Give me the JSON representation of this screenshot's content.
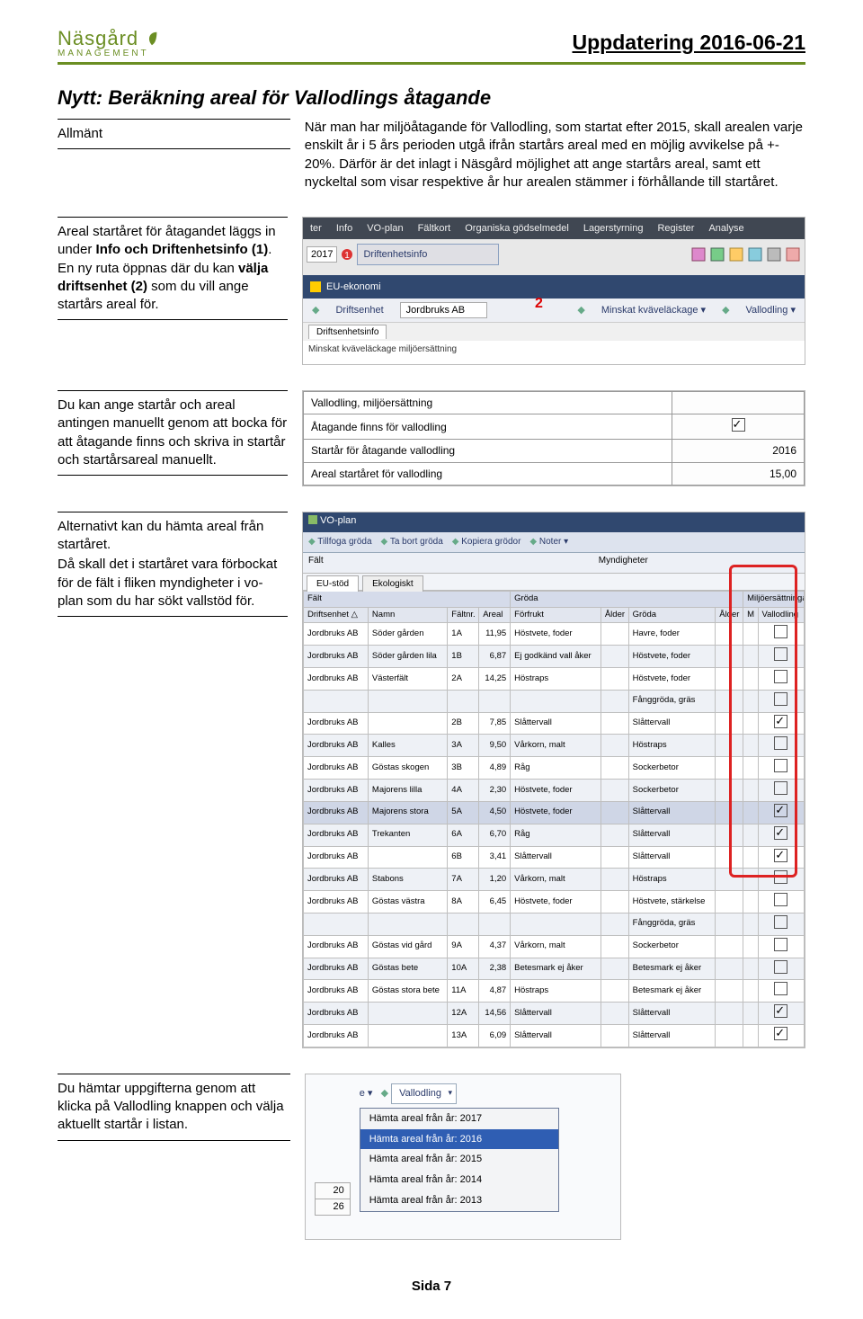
{
  "header": {
    "logo_top": "Näsgård",
    "logo_bottom": "MANAGEMENT",
    "doc_title": "Uppdatering 2016-06-21"
  },
  "section_title": "Nytt: Beräkning areal för Vallodlings åtagande",
  "block1": {
    "label": "Allmänt",
    "body": "När man har miljöåtagande för Vallodling, som startat efter 2015, skall arealen varje enskilt år i 5 års perioden utgå ifrån startårs areal med en möjlig avvikelse på +- 20%. Därför är det inlagt i Näsgård möjlighet att ange startårs areal, samt ett nyckeltal som visar respektive år hur arealen stämmer i förhållande till startåret."
  },
  "block2": {
    "text_a": "Areal startåret för åtagandet läggs in under ",
    "bold_a": "Info och Driftenhetsinfo (1)",
    "text_b": ". En ny ruta öppnas där du kan ",
    "bold_b": "välja driftsenhet (2)",
    "text_c": " som du vill ange startårs areal för."
  },
  "img1": {
    "menu": [
      "ter",
      "Info",
      "VO-plan",
      "Fältkort",
      "Organiska gödselmedel",
      "Lagerstyrning",
      "Register",
      "Analyse"
    ],
    "year_btn": "2017",
    "dropdown": "Driftenhetsinfo",
    "eu_header": "EU-ekonomi",
    "driftsenhet_label": "Driftsenhet",
    "driftsenhet_value": "Jordbruks AB",
    "minskat": "Minskat kväveläckage ▾",
    "vallodling": "Vallodling ▾",
    "tab": "Driftsenhetsinfo",
    "subline": "Minskat kväveläckage  miljöersättning",
    "red2": "2"
  },
  "block3": {
    "text": "Du kan ange startår och areal antingen manuellt genom att bocka för att åtagande finns och skriva in startår och startårsareal manuellt."
  },
  "img2": {
    "rows": [
      {
        "label": "Vallodling, miljöersättning",
        "value": ""
      },
      {
        "label": "Åtagande finns för vallodling",
        "chk": true
      },
      {
        "label": "Startår för åtagande vallodling",
        "value": "2016"
      },
      {
        "label": "Areal startåret för vallodling",
        "value": "15,00"
      }
    ]
  },
  "block4": {
    "line1": "Alternativt kan du hämta areal från startåret.",
    "line2": "Då skall det i startåret vara förbockat för de fält i fliken myndigheter i vo-plan som du har sökt vallstöd för."
  },
  "img3": {
    "head": "VO-plan",
    "toolbar": [
      "Tillfoga gröda",
      "Ta bort gröda",
      "Kopiera grödor",
      "Noter ▾"
    ],
    "left_group": "Fält",
    "right_group": "Myndigheter",
    "tab1": "EU-stöd",
    "tab2": "Ekologiskt",
    "group_falt": "Fält",
    "group_groda": "Gröda",
    "group_milj": "Miljöersättningar",
    "cols": [
      "Driftsenhet △",
      "Namn",
      "Fältnr.",
      "Areal",
      "Förfrukt",
      "Ålder",
      "Gröda",
      "Ålder",
      "M",
      "Vallodling"
    ],
    "rows": [
      [
        "Jordbruks AB",
        "Söder gården",
        "1A",
        "11,95",
        "Höstvete, foder",
        "",
        "Havre, foder",
        "",
        "",
        false
      ],
      [
        "Jordbruks AB",
        "Söder gården lila",
        "1B",
        "6,87",
        "Ej godkänd vall åker",
        "",
        "Höstvete, foder",
        "",
        "",
        false
      ],
      [
        "Jordbruks AB",
        "Västerfält",
        "2A",
        "14,25",
        "Höstraps",
        "",
        "Höstvete, foder",
        "",
        "",
        false
      ],
      [
        "",
        "",
        "",
        "",
        "",
        "",
        "Fånggröda, gräs",
        "",
        "",
        false
      ],
      [
        "Jordbruks AB",
        "",
        "2B",
        "7,85",
        "Slåttervall",
        "",
        "Slåttervall",
        "",
        "",
        true
      ],
      [
        "Jordbruks AB",
        "Kalles",
        "3A",
        "9,50",
        "Vårkorn, malt",
        "",
        "Höstraps",
        "",
        "",
        false
      ],
      [
        "Jordbruks AB",
        "Göstas skogen",
        "3B",
        "4,89",
        "Råg",
        "",
        "Sockerbetor",
        "",
        "",
        false
      ],
      [
        "Jordbruks AB",
        "Majorens lilla",
        "4A",
        "2,30",
        "Höstvete, foder",
        "",
        "Sockerbetor",
        "",
        "",
        false
      ],
      [
        "Jordbruks AB",
        "Majorens stora",
        "5A",
        "4,50",
        "Höstvete, foder",
        "",
        "Slåttervall",
        "",
        "",
        true
      ],
      [
        "Jordbruks AB",
        "Trekanten",
        "6A",
        "6,70",
        "Råg",
        "",
        "Slåttervall",
        "",
        "",
        true
      ],
      [
        "Jordbruks AB",
        "",
        "6B",
        "3,41",
        "Slåttervall",
        "",
        "Slåttervall",
        "",
        "",
        true
      ],
      [
        "Jordbruks AB",
        "Stabons",
        "7A",
        "1,20",
        "Vårkorn, malt",
        "",
        "Höstraps",
        "",
        "",
        false
      ],
      [
        "Jordbruks AB",
        "Göstas västra",
        "8A",
        "6,45",
        "Höstvete, foder",
        "",
        "Höstvete, stärkelse",
        "",
        "",
        false
      ],
      [
        "",
        "",
        "",
        "",
        "",
        "",
        "Fånggröda, gräs",
        "",
        "",
        false
      ],
      [
        "Jordbruks AB",
        "Göstas vid gård",
        "9A",
        "4,37",
        "Vårkorn, malt",
        "",
        "Sockerbetor",
        "",
        "",
        false
      ],
      [
        "Jordbruks AB",
        "Göstas bete",
        "10A",
        "2,38",
        "Betesmark ej åker",
        "",
        "Betesmark ej åker",
        "",
        "",
        false
      ],
      [
        "Jordbruks AB",
        "Göstas stora bete",
        "11A",
        "4,87",
        "Höstraps",
        "",
        "Betesmark ej åker",
        "",
        "",
        false
      ],
      [
        "Jordbruks AB",
        "",
        "12A",
        "14,56",
        "Slåttervall",
        "",
        "Slåttervall",
        "",
        "",
        true
      ],
      [
        "Jordbruks AB",
        "",
        "13A",
        "6,09",
        "Slåttervall",
        "",
        "Slåttervall",
        "",
        "",
        true
      ]
    ],
    "sel_index": 8
  },
  "block5": {
    "text": "Du hämtar uppgifterna genom att klicka på Vallodling knappen och välja aktuellt startår i listan."
  },
  "img4": {
    "prefix": "e ▾",
    "button": "Vallodling",
    "items": [
      "Hämta areal från år: 2017",
      "Hämta areal från år: 2016",
      "Hämta areal från år: 2015",
      "Hämta areal från år: 2014",
      "Hämta areal från år: 2013"
    ],
    "hl_index": 1,
    "side": [
      "20",
      "26"
    ]
  },
  "footer": "Sida 7"
}
